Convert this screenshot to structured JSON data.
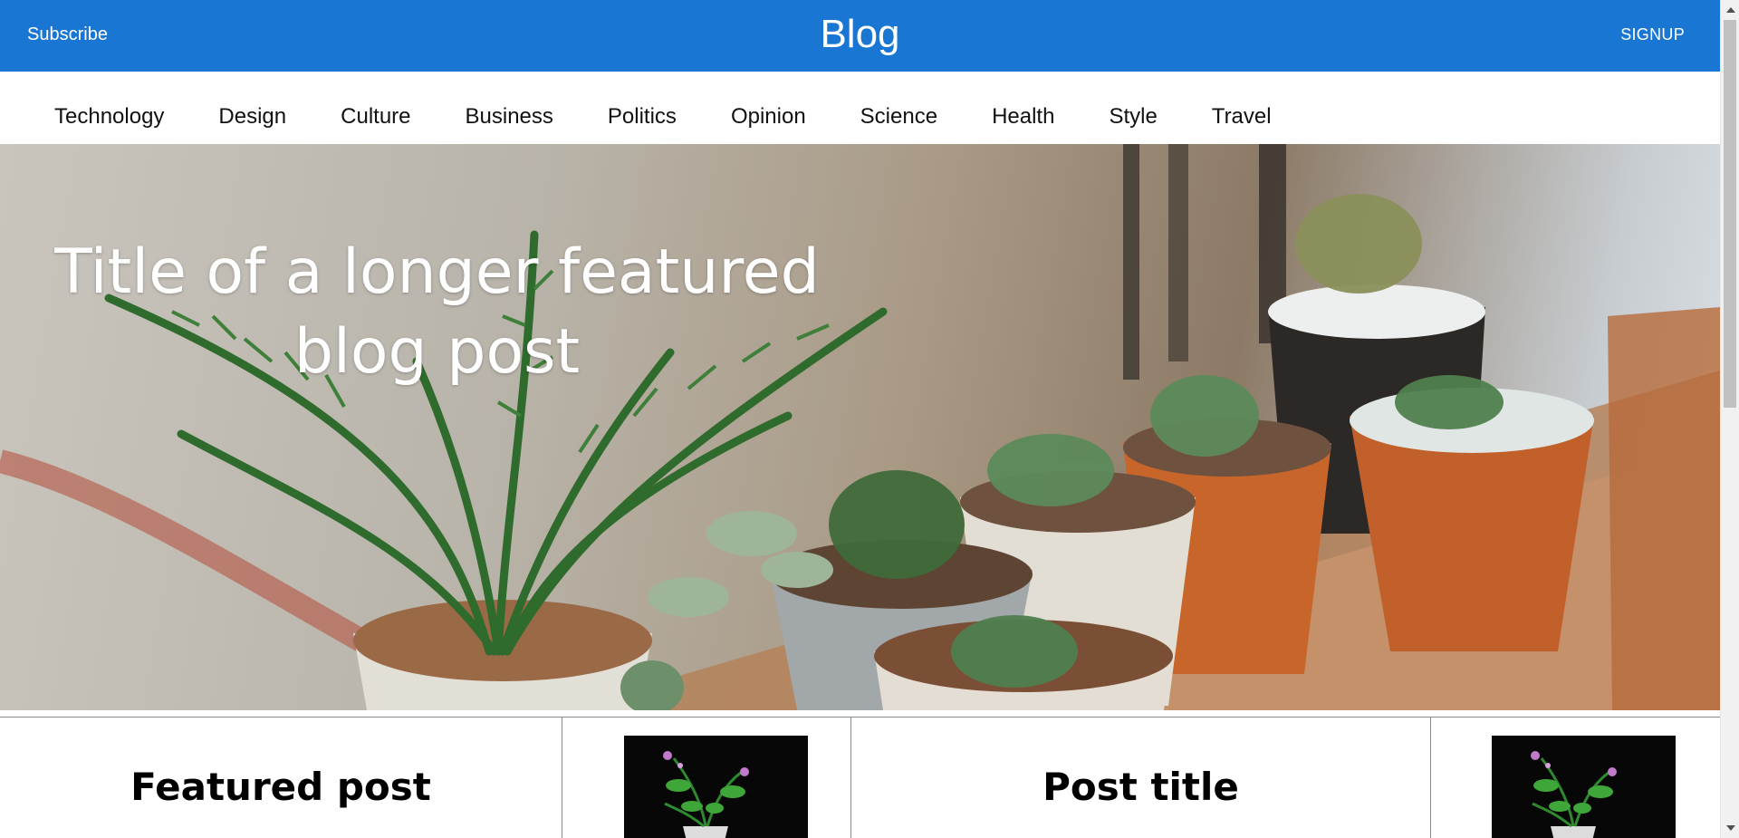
{
  "header": {
    "subscribe_label": "Subscribe",
    "brand": "Blog",
    "signup_label": "SIGNUP",
    "color": "#1976d2"
  },
  "categories": [
    "Technology",
    "Design",
    "Culture",
    "Business",
    "Politics",
    "Opinion",
    "Science",
    "Health",
    "Style",
    "Travel"
  ],
  "hero": {
    "title": "Title of a longer featured blog post",
    "image": "potted-succulents-photo"
  },
  "cards": [
    {
      "title": "Featured post",
      "thumbnail": "flower-pot-photo"
    },
    {
      "title": "Post title",
      "thumbnail": "flower-pot-photo"
    }
  ]
}
